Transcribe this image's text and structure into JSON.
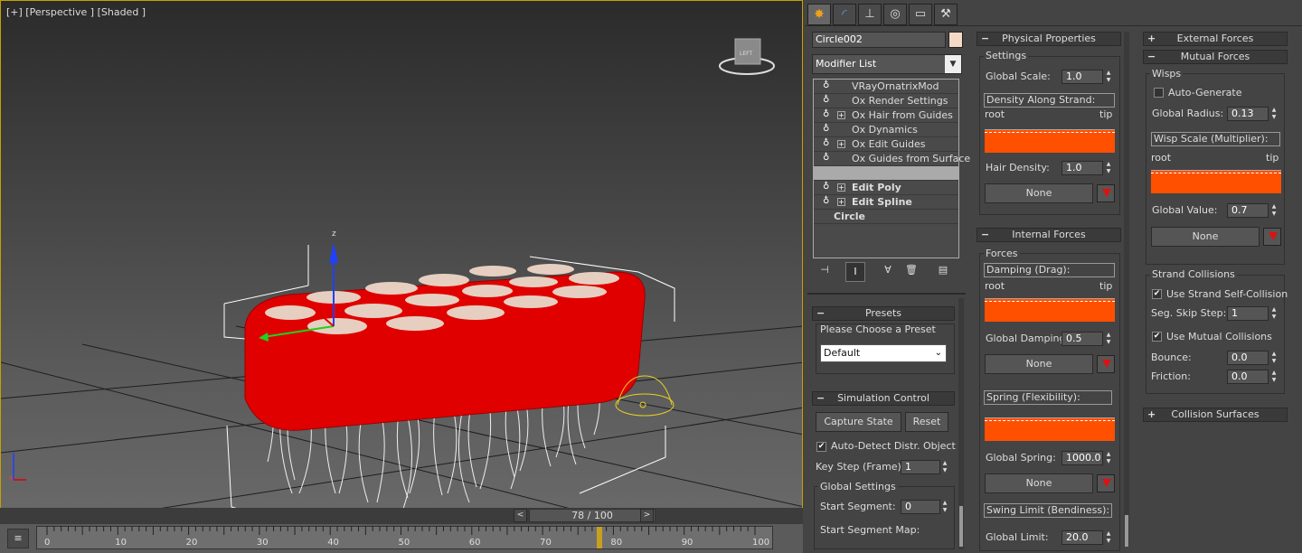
{
  "viewport": {
    "label": "[+] [Perspective ] [Shaded ]",
    "cube_label": "LEFT"
  },
  "timeline": {
    "frame_text": "78 / 100",
    "prev": "<",
    "next": ">",
    "ticks": [
      "0",
      "10",
      "20",
      "30",
      "40",
      "50",
      "60",
      "70",
      "80",
      "90",
      "100"
    ],
    "current_frame": 78
  },
  "command_tabs": [
    "create-icon",
    "modify-icon",
    "hierarchy-icon",
    "motion-icon",
    "display-icon",
    "utilities-icon"
  ],
  "object": {
    "name": "Circle002",
    "color": "#f3d9c6",
    "modifier_list": "Modifier List"
  },
  "stack": [
    {
      "label": "VRayOrnatrixMod",
      "bold": false,
      "plus": false
    },
    {
      "label": "Ox Render Settings",
      "bold": false,
      "plus": false
    },
    {
      "label": "Ox Hair from Guides",
      "bold": false,
      "plus": true
    },
    {
      "label": "Ox Dynamics",
      "bold": false,
      "plus": false
    },
    {
      "label": "Ox Edit Guides",
      "bold": false,
      "plus": true
    },
    {
      "label": "Ox Guides from Surface",
      "bold": false,
      "plus": false
    },
    {
      "label": "",
      "bold": false,
      "plus": false
    },
    {
      "label": "Edit Poly",
      "bold": true,
      "plus": true
    },
    {
      "label": "Edit Spline",
      "bold": true,
      "plus": true
    },
    {
      "label": "Circle",
      "bold": true,
      "plus": false
    }
  ],
  "presets": {
    "title": "Presets",
    "prompt": "Please Choose a Preset",
    "selected": "Default"
  },
  "simulation": {
    "title": "Simulation Control",
    "capture": "Capture State",
    "reset": "Reset",
    "auto_detect": "Auto-Detect Distr. Object",
    "key_step_label": "Key Step (Frame):",
    "key_step": "1",
    "global_settings": "Global Settings",
    "start_segment_label": "Start Segment:",
    "start_segment": "0",
    "start_segment_map": "Start Segment Map:"
  },
  "physical": {
    "title": "Physical Properties",
    "settings": "Settings",
    "global_scale_label": "Global Scale:",
    "global_scale": "1.0",
    "density_label": "Density Along Strand:",
    "root": "root",
    "tip": "tip",
    "hair_density_label": "Hair Density:",
    "hair_density": "1.0",
    "none": "None"
  },
  "internal": {
    "title": "Internal Forces",
    "forces": "Forces",
    "damping_label": "Damping (Drag):",
    "root": "root",
    "tip": "tip",
    "global_damping_label": "Global Damping:",
    "global_damping": "0.5",
    "none": "None",
    "spring_label": "Spring (Flexibility):",
    "global_spring_label": "Global Spring:",
    "global_spring": "1000.0",
    "swing_label": "Swing Limit (Bendiness):",
    "global_limit_label": "Global Limit:",
    "global_limit": "20.0"
  },
  "external": {
    "title": "External Forces"
  },
  "mutual": {
    "title": "Mutual Forces",
    "wisps": "Wisps",
    "auto_generate": "Auto-Generate",
    "global_radius_label": "Global Radius:",
    "global_radius": "0.13",
    "wisp_scale_label": "Wisp Scale (Multiplier):",
    "root": "root",
    "tip": "tip",
    "global_value_label": "Global Value:",
    "global_value": "0.7",
    "none": "None",
    "strand_collisions": "Strand Collisions",
    "self_collision": "Use Strand Self-Collision",
    "seg_skip_label": "Seg. Skip Step:",
    "seg_skip": "1",
    "mutual_collisions": "Use Mutual Collisions",
    "bounce_label": "Bounce:",
    "bounce": "0.0",
    "friction_label": "Friction:",
    "friction": "0.0"
  },
  "collision": {
    "title": "Collision Surfaces"
  },
  "colors": {
    "accent": "#ff5000",
    "selection": "#c8a000",
    "object": "#e00000"
  }
}
